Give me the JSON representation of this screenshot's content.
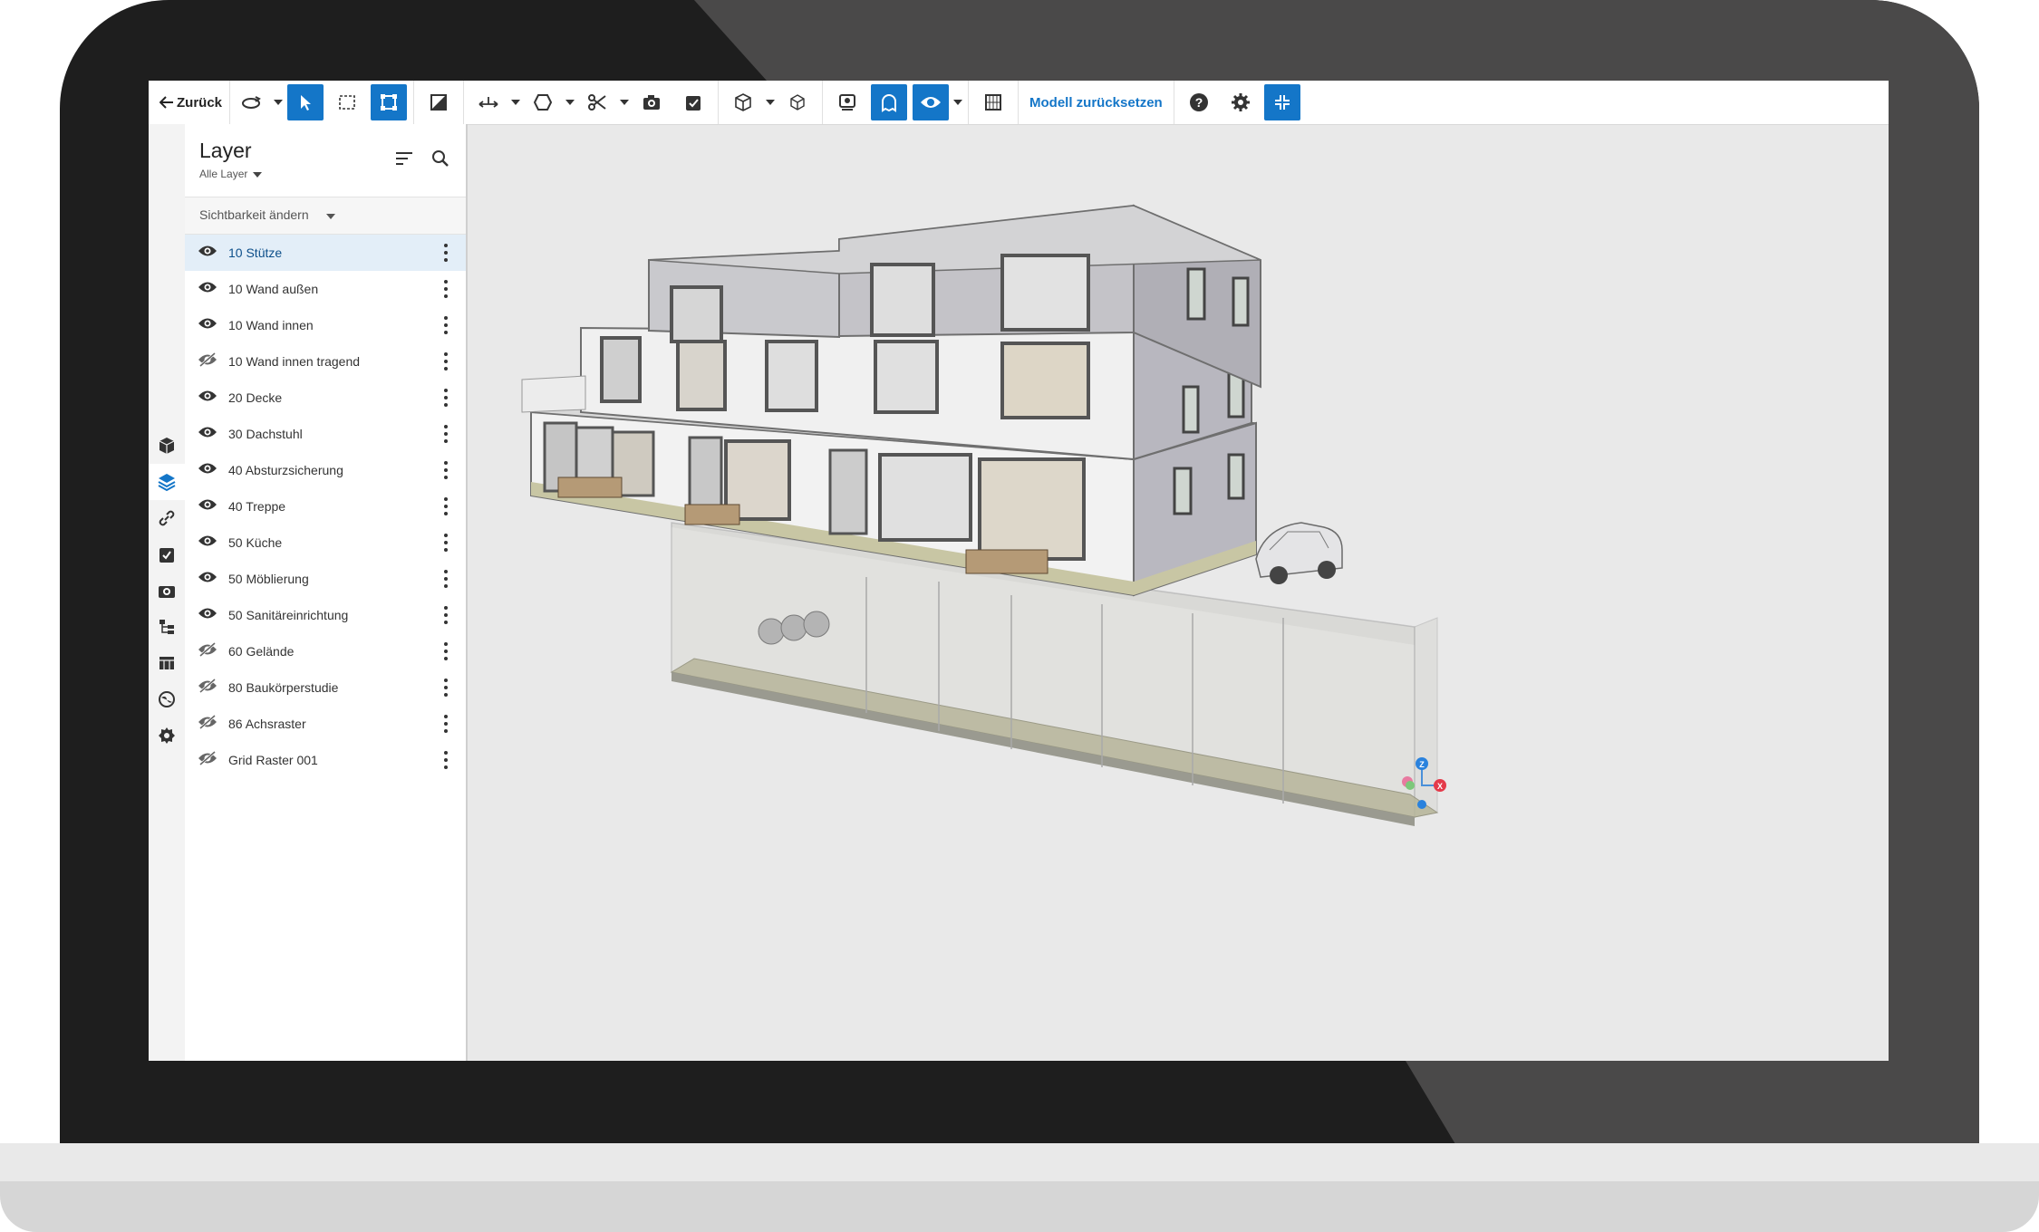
{
  "toolbar": {
    "back_label": "Zurück",
    "reset_model_label": "Modell zurücksetzen",
    "tools": [
      "orbit-icon",
      "select-cursor-icon",
      "box-select-icon",
      "fit-icon",
      "section-icon",
      "measure-icon",
      "shape-icon",
      "cut-icon",
      "snapshot-icon",
      "task-icon",
      "cube-icon",
      "cube-outline-icon",
      "layer-view-icon",
      "ghost-icon",
      "visibility-icon",
      "grid-icon",
      "help-icon",
      "settings-icon",
      "collapse-icon"
    ]
  },
  "rail": {
    "items": [
      "model-icon",
      "layers-icon",
      "link-icon",
      "checklist-icon",
      "camera-icon",
      "tree-icon",
      "table-icon",
      "globe-icon",
      "badge-icon"
    ]
  },
  "panel": {
    "title": "Layer",
    "subtitle": "Alle Layer",
    "visibility_label": "Sichtbarkeit ändern",
    "layers": [
      {
        "label": "10 Stütze",
        "visible": true,
        "selected": true
      },
      {
        "label": "10 Wand außen",
        "visible": true
      },
      {
        "label": "10 Wand innen",
        "visible": true
      },
      {
        "label": "10 Wand innen tragend",
        "visible": false
      },
      {
        "label": "20 Decke",
        "visible": true
      },
      {
        "label": "30 Dachstuhl",
        "visible": true
      },
      {
        "label": "40 Absturzsicherung",
        "visible": true
      },
      {
        "label": "40 Treppe",
        "visible": true
      },
      {
        "label": "50 Küche",
        "visible": true
      },
      {
        "label": "50 Möblierung",
        "visible": true
      },
      {
        "label": "50 Sanitäreinrichtung",
        "visible": true
      },
      {
        "label": "60 Gelände",
        "visible": false
      },
      {
        "label": "80 Baukörperstudie",
        "visible": false
      },
      {
        "label": "86 Achsraster",
        "visible": false
      },
      {
        "label": "Grid Raster 001",
        "visible": false
      }
    ]
  },
  "axis": {
    "z": "Z",
    "x": "X"
  },
  "colors": {
    "accent": "#1476c8",
    "bezel": "#1e1e1e",
    "viewport_bg": "#e9e9e9"
  }
}
